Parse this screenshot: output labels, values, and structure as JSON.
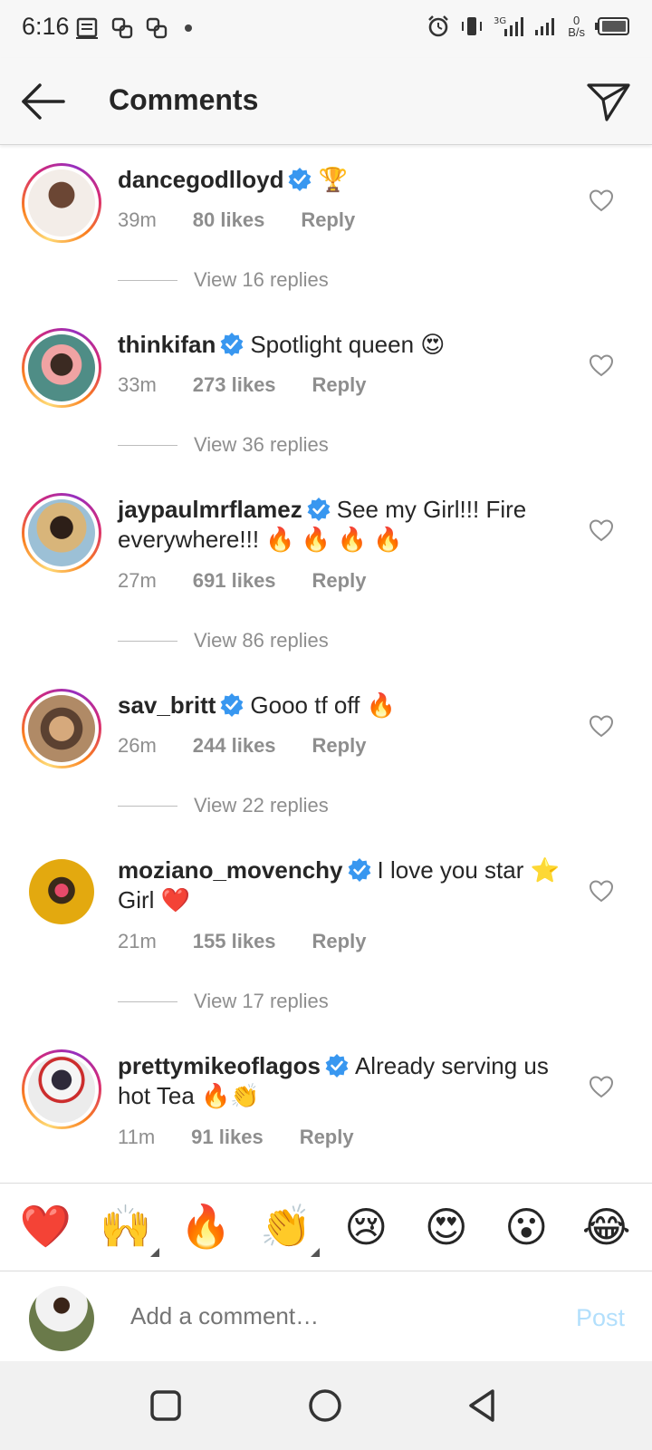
{
  "status_bar": {
    "time": "6:16",
    "net_speed_top": "0",
    "net_speed_unit": "B/s",
    "network": "3G"
  },
  "header": {
    "title": "Comments"
  },
  "comments": [
    {
      "username": "dancegodlloyd",
      "text": "",
      "emojis": "🏆",
      "time": "39m",
      "likes": "80 likes",
      "reply": "Reply",
      "view_replies": "View 16 replies",
      "verified": true,
      "story_ring": true,
      "avatar_color": "#e9d5c9"
    },
    {
      "username": "thinkifan",
      "text": "Spotlight queen",
      "emojis": "😍",
      "time": "33m",
      "likes": "273 likes",
      "reply": "Reply",
      "view_replies": "View 36 replies",
      "verified": true,
      "story_ring": true,
      "avatar_color": "#4f8d86"
    },
    {
      "username": "jaypaulmrflamez",
      "text": "See my Girl!!! Fire everywhere!!!",
      "emojis": "🔥 🔥 🔥 🔥",
      "time": "27m",
      "likes": "691 likes",
      "reply": "Reply",
      "view_replies": "View 86 replies",
      "verified": true,
      "story_ring": true,
      "avatar_color": "#c9ad7e"
    },
    {
      "username": "sav_britt",
      "text": "Gooo tf off",
      "emojis": "🔥",
      "time": "26m",
      "likes": "244 likes",
      "reply": "Reply",
      "view_replies": "View 22 replies",
      "verified": true,
      "story_ring": true,
      "avatar_color": "#b08a66"
    },
    {
      "username": "moziano_movenchy",
      "text": "I love you star",
      "text2": "Girl",
      "emoji_mid": "⭐",
      "emojis": "❤️",
      "time": "21m",
      "likes": "155 likes",
      "reply": "Reply",
      "view_replies": "View 17 replies",
      "verified": true,
      "story_ring": false,
      "avatar_color": "#e3a90f"
    },
    {
      "username": "prettymikeoflagos",
      "text": "Already serving us hot Tea",
      "emojis": "🔥👏",
      "time": "11m",
      "likes": "91 likes",
      "reply": "Reply",
      "verified": true,
      "story_ring": true,
      "avatar_color": "#d9d9d9"
    }
  ],
  "emoji_bar": [
    "❤️",
    "🙌",
    "🔥",
    "👏",
    "😢",
    "😍",
    "😮",
    "😂"
  ],
  "input": {
    "placeholder": "Add a comment…",
    "post_label": "Post"
  },
  "colors": {
    "verified": "#3897f0",
    "post_disabled": "#b2dffc",
    "meta_gray": "#8e8e8e"
  }
}
